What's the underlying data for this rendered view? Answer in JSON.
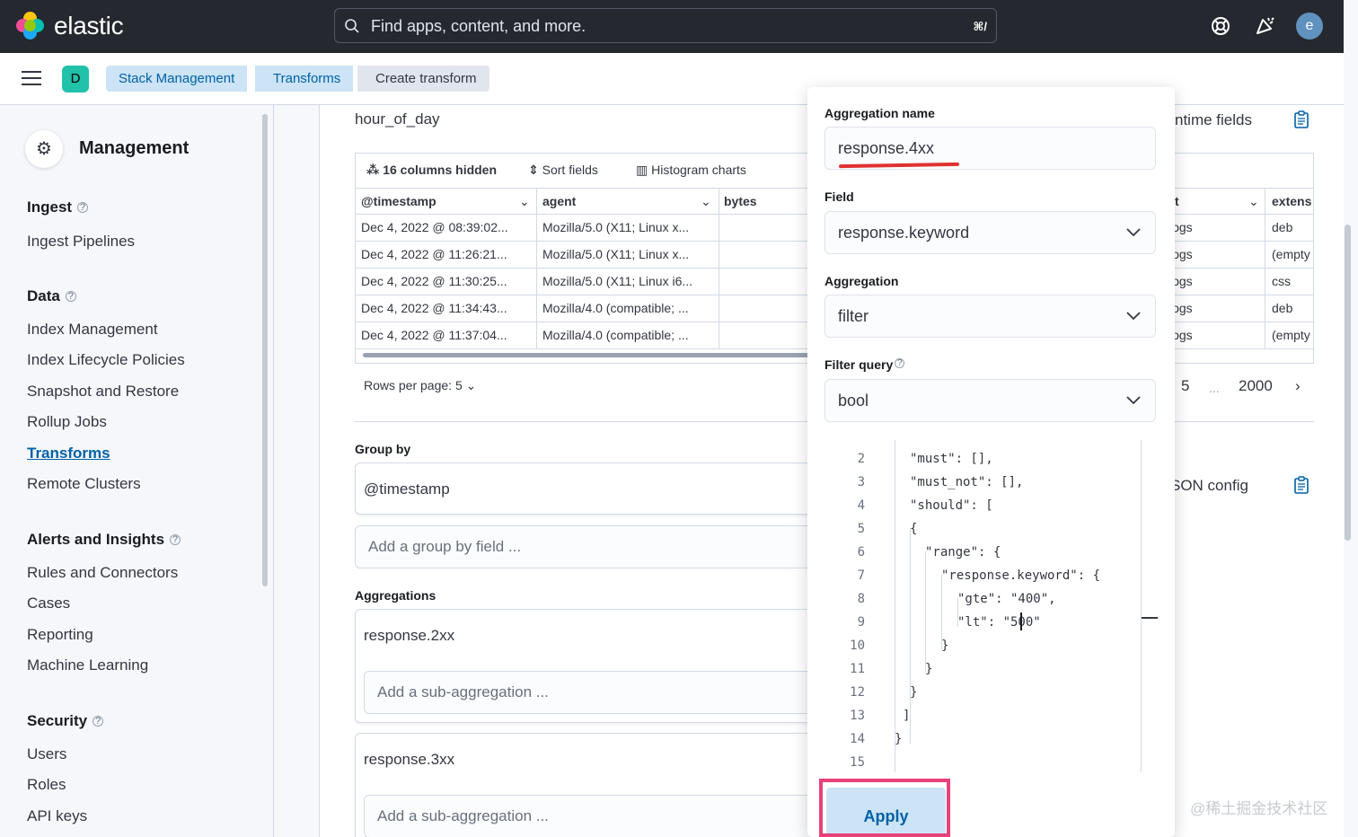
{
  "header": {
    "brand": "elastic",
    "search_placeholder": "Find apps, content, and more.",
    "search_shortcut": "⌘/",
    "avatar_initial": "e"
  },
  "breadcrumbs": {
    "space_initial": "D",
    "items": [
      "Stack Management",
      "Transforms",
      "Create transform"
    ]
  },
  "sidebar": {
    "title": "Management",
    "sections": [
      {
        "title": "Ingest",
        "items": [
          "Ingest Pipelines"
        ]
      },
      {
        "title": "Data",
        "items": [
          "Index Management",
          "Index Lifecycle Policies",
          "Snapshot and Restore",
          "Rollup Jobs",
          "Transforms",
          "Remote Clusters"
        ]
      },
      {
        "title": "Alerts and Insights",
        "items": [
          "Rules and Connectors",
          "Cases",
          "Reporting",
          "Machine Learning"
        ]
      },
      {
        "title": "Security",
        "items": [
          "Users",
          "Roles",
          "API keys"
        ]
      }
    ],
    "active_item": "Transforms"
  },
  "main": {
    "field_hour_of_day": "hour_of_day",
    "runtime_fields_label": "ntime fields",
    "json_config_label": "SON config",
    "grid": {
      "toolbar": {
        "hidden": "16 columns hidden",
        "sort": "Sort fields",
        "histogram": "Histogram charts"
      },
      "columns": [
        "@timestamp",
        "agent",
        "bytes",
        "t",
        "extens"
      ],
      "rows": [
        [
          "Dec 4, 2022 @ 08:39:02...",
          "Mozilla/5.0 (X11; Linux x...",
          "",
          "logs",
          "deb"
        ],
        [
          "Dec 4, 2022 @ 11:26:21...",
          "Mozilla/5.0 (X11; Linux x...",
          "",
          "logs",
          "(empty"
        ],
        [
          "Dec 4, 2022 @ 11:30:25...",
          "Mozilla/5.0 (X11; Linux i6...",
          "",
          "logs",
          "css"
        ],
        [
          "Dec 4, 2022 @ 11:34:43...",
          "Mozilla/4.0 (compatible; ...",
          "",
          "logs",
          "deb"
        ],
        [
          "Dec 4, 2022 @ 11:37:04...",
          "Mozilla/4.0 (compatible; ...",
          "",
          "logs",
          "(empty"
        ]
      ]
    },
    "rows_per_page": "Rows per page: 5",
    "pager": {
      "current": "5",
      "ellipsis": "...",
      "last": "2000"
    },
    "group_by": {
      "label": "Group by",
      "value": "@timestamp",
      "add_placeholder": "Add a group by field ..."
    },
    "aggregations": {
      "label": "Aggregations",
      "items": [
        {
          "name": "response.2xx",
          "sub_placeholder": "Add a sub-aggregation ..."
        },
        {
          "name": "response.3xx",
          "sub_placeholder": "Add a sub-aggregation ..."
        }
      ]
    }
  },
  "popover": {
    "agg_name_label": "Aggregation name",
    "agg_name_value": "response.4xx",
    "field_label": "Field",
    "field_value": "response.keyword",
    "aggregation_label": "Aggregation",
    "aggregation_value": "filter",
    "filter_query_label": "Filter query",
    "filter_query_value": "bool",
    "code_lines": [
      {
        "n": "2",
        "text": "\"must\": [],"
      },
      {
        "n": "3",
        "text": "\"must_not\": [],"
      },
      {
        "n": "4",
        "text": "\"should\": ["
      },
      {
        "n": "5",
        "text": "{"
      },
      {
        "n": "6",
        "text": "\"range\": {"
      },
      {
        "n": "7",
        "text": "\"response.keyword\": {"
      },
      {
        "n": "8",
        "text": "\"gte\": \"400\","
      },
      {
        "n": "9",
        "text": "\"lt\": \"500\""
      },
      {
        "n": "10",
        "text": "}"
      },
      {
        "n": "11",
        "text": "}"
      },
      {
        "n": "12",
        "text": "}"
      },
      {
        "n": "13",
        "text": "]"
      },
      {
        "n": "14",
        "text": "}"
      },
      {
        "n": "15",
        "text": ""
      }
    ],
    "apply_label": "Apply"
  },
  "watermark": "@稀土掘金技术社区",
  "colors": {
    "header_bg": "#25282f",
    "link": "#0061a6",
    "breadcrumb_bg": "#cce4f5",
    "highlight_pink": "#e8427a",
    "underline_red": "#e03131"
  }
}
